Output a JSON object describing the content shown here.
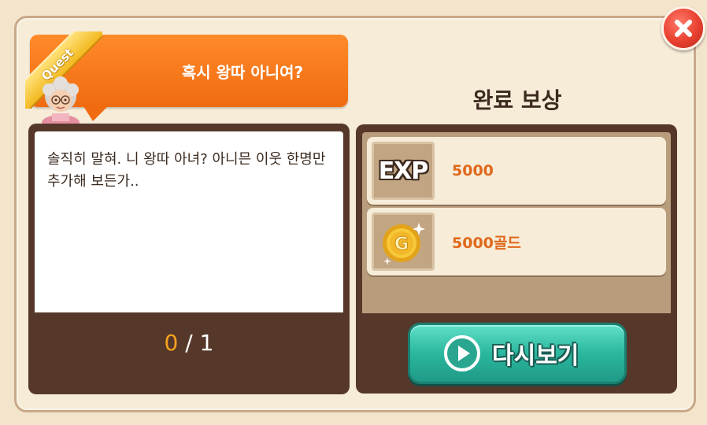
{
  "quest": {
    "badge_label": "Quest",
    "title": "혹시 왕따 아니여?",
    "description": "솔직히 말혀. 니 왕따 아녀? 아니믄 이웃 한명만 추가해 보든가..",
    "progress_current": "0",
    "progress_separator": " / ",
    "progress_total": "1"
  },
  "rewards": {
    "title": "완료 보상",
    "items": [
      {
        "icon": "exp-icon",
        "icon_label": "EXP",
        "value": "5000"
      },
      {
        "icon": "gold-coin-icon",
        "icon_label": "G",
        "value": "5000골드"
      }
    ]
  },
  "buttons": {
    "replay_label": "다시보기",
    "close_icon": "close-icon"
  },
  "colors": {
    "accent_orange": "#f06b10",
    "reward_value": "#e0681a",
    "progress_current": "#f5a21e",
    "replay_button": "#2bb79f",
    "close_button": "#e8402f",
    "panel_dark": "#56382a"
  }
}
